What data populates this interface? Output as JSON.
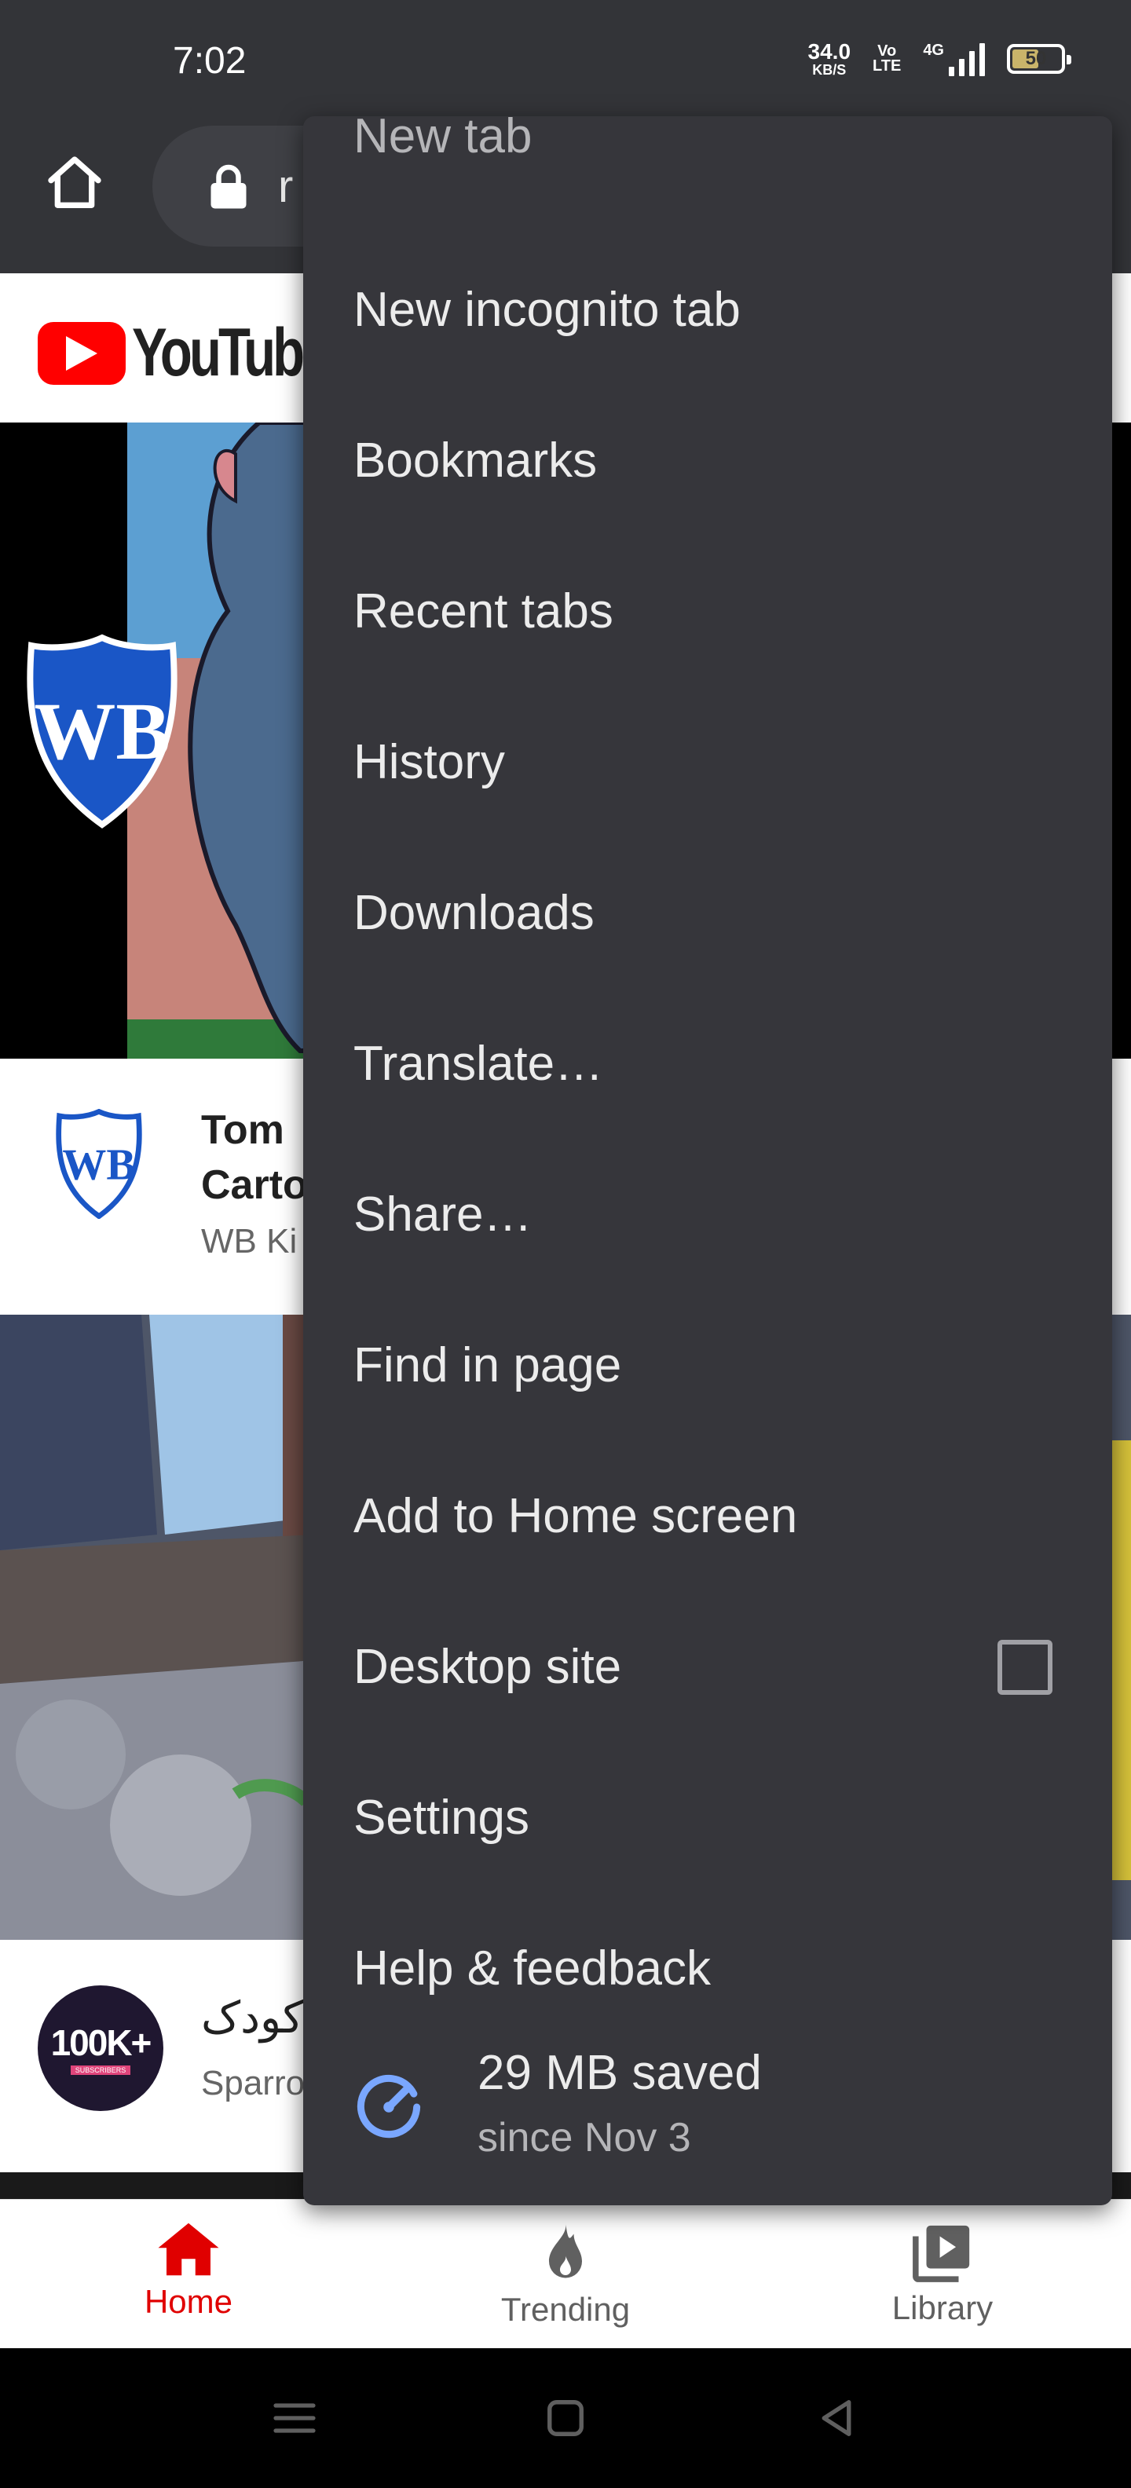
{
  "status_bar": {
    "time": "7:02",
    "net_speed_value": "34.0",
    "net_speed_unit": "KB/S",
    "volte_top": "Vo",
    "volte_bottom": "LTE",
    "network": "4G",
    "battery": "50"
  },
  "toolbar": {
    "url_partial": "r",
    "home_icon": "home-icon",
    "lock_icon": "lock-icon"
  },
  "page": {
    "logo_text": "YouTube",
    "video1": {
      "title_line1": "Tom",
      "title_line2": "Carto",
      "channel": "WB Ki"
    },
    "video2": {
      "title": "کودک",
      "channel": "Sparro",
      "avatar_big": "100K+",
      "avatar_small": "SUBSCRIBERS"
    }
  },
  "bottom_nav": {
    "items": [
      {
        "label": "Home",
        "icon": "home-icon",
        "active": true
      },
      {
        "label": "Trending",
        "icon": "flame-icon",
        "active": false
      },
      {
        "label": "Library",
        "icon": "library-icon",
        "active": false
      }
    ]
  },
  "menu": {
    "partial_item": "New tab",
    "items": [
      {
        "label": "New incognito tab"
      },
      {
        "label": "Bookmarks"
      },
      {
        "label": "Recent tabs"
      },
      {
        "label": "History"
      },
      {
        "label": "Downloads"
      },
      {
        "label": "Translate…"
      },
      {
        "label": "Share…"
      },
      {
        "label": "Find in page"
      },
      {
        "label": "Add to Home screen"
      },
      {
        "label": "Desktop site",
        "checked": false
      },
      {
        "label": "Settings"
      },
      {
        "label": "Help & feedback"
      }
    ],
    "savings_main": "29 MB saved",
    "savings_sub": "since Nov 3"
  },
  "colors": {
    "menu_bg": "#36363b",
    "toolbar_bg": "#333438",
    "accent_red": "#ff0000",
    "savings_icon": "#7aa7ff"
  }
}
